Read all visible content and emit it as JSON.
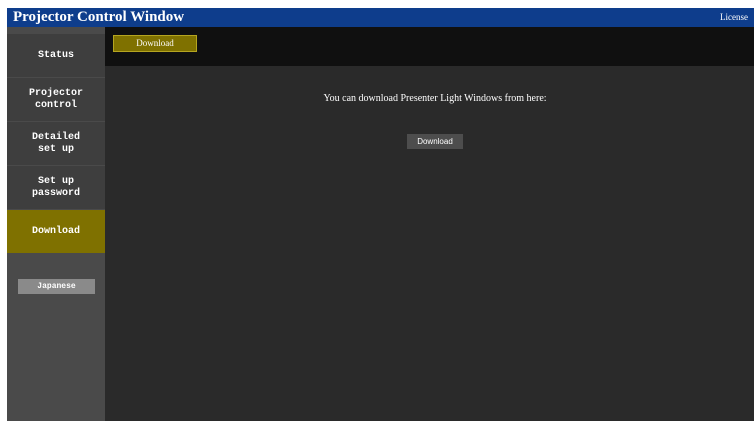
{
  "window": {
    "title": "Projector Control Window",
    "license_label": "License"
  },
  "sidebar": {
    "items": [
      {
        "label": "Status"
      },
      {
        "label": "Projector\ncontrol"
      },
      {
        "label": "Detailed\nset up"
      },
      {
        "label": "Set up\npassword"
      },
      {
        "label": "Download",
        "active": true
      }
    ],
    "language_button": "Japanese"
  },
  "tabs": [
    {
      "label": "Download",
      "active": true
    }
  ],
  "main": {
    "message": "You can download Presenter Light Windows from here:",
    "download_button": "Download"
  },
  "colors": {
    "title_bar": "#0e3d8c",
    "active_accent": "#7f7100",
    "sidebar_bg": "#4a4a4a",
    "content_bg": "#2a2a2a",
    "tab_strip_bg": "#101010"
  }
}
